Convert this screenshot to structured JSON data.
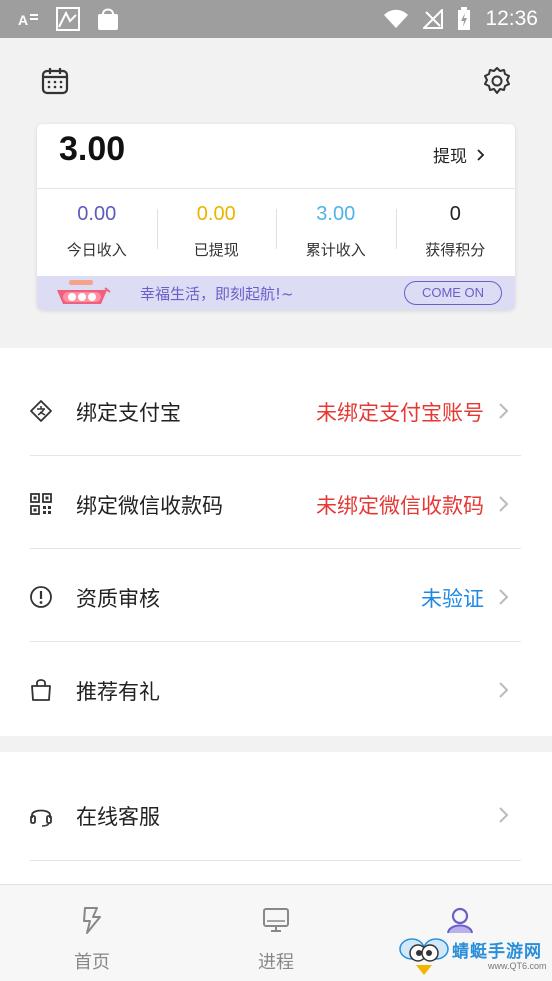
{
  "status_bar": {
    "time": "12:36"
  },
  "wallet": {
    "balance": "3.00",
    "withdraw_label": "提现",
    "stats": [
      {
        "value": "0.00",
        "label": "今日收入",
        "color": "#5b5bbf"
      },
      {
        "value": "0.00",
        "label": "已提现",
        "color": "#e8b500"
      },
      {
        "value": "3.00",
        "label": "累计收入",
        "color": "#4fb3e8"
      },
      {
        "value": "0",
        "label": "获得积分",
        "color": "#222222"
      }
    ],
    "banner_text": "幸福生活，即刻起航!~",
    "banner_button": "COME ON"
  },
  "menu": [
    {
      "label": "绑定支付宝",
      "value": "未绑定支付宝账号",
      "value_color": "#e53935",
      "icon": "alipay-icon"
    },
    {
      "label": "绑定微信收款码",
      "value": "未绑定微信收款码",
      "value_color": "#e53935",
      "icon": "qrcode-icon"
    },
    {
      "label": "资质审核",
      "value": "未验证",
      "value_color": "#1e88e5",
      "icon": "alert-circle-icon"
    },
    {
      "label": "推荐有礼",
      "value": "",
      "icon": "gift-bag-icon"
    }
  ],
  "menu2": [
    {
      "label": "在线客服",
      "icon": "headset-icon"
    }
  ],
  "tabs": [
    {
      "label": "首页",
      "icon": "lightning-icon"
    },
    {
      "label": "进程",
      "icon": "monitor-icon"
    },
    {
      "label": "",
      "icon": "user-icon",
      "active": true
    }
  ],
  "watermark": {
    "title": "蜻蜓手游网",
    "sub": "www.QT6.com"
  }
}
